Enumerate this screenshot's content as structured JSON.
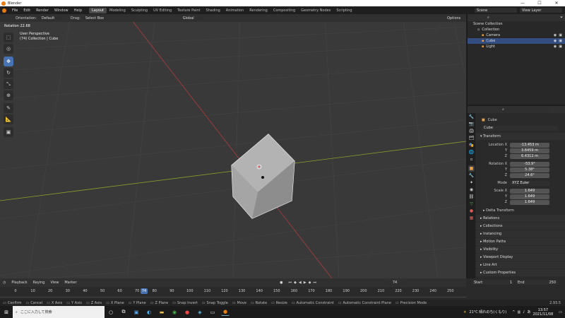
{
  "titlebar": {
    "app": "Blender",
    "min": "—",
    "max": "☐",
    "close": "✕"
  },
  "menubar": {
    "items": [
      "File",
      "Edit",
      "Render",
      "Window",
      "Help"
    ],
    "workspaces": [
      "Layout",
      "Modeling",
      "Sculpting",
      "UV Editing",
      "Texture Paint",
      "Shading",
      "Animation",
      "Rendering",
      "Compositing",
      "Geometry Nodes",
      "Scripting"
    ],
    "active_workspace": "Layout",
    "scene_label": "Scene",
    "view_layer_label": "View Layer"
  },
  "viewport_header": {
    "orientation_label": "Orientation:",
    "orientation_value": "Default",
    "drag_label": "Drag:",
    "drag_value": "Select Box",
    "transform_space": "Global",
    "options": "Options"
  },
  "viewport": {
    "rotation_readout": "Rotation 22.68",
    "view_name": "User Perspective",
    "collection_info": "(74) Collection | Cube"
  },
  "outliner": {
    "root": "Scene Collection",
    "collection": "Collection",
    "items": [
      {
        "name": "Camera",
        "icon": "camera-icon",
        "color": "#e6a04a",
        "selected": false
      },
      {
        "name": "Cube",
        "icon": "mesh-icon",
        "color": "#e6a04a",
        "selected": true
      },
      {
        "name": "Light",
        "icon": "light-icon",
        "color": "#e6a04a",
        "selected": false
      }
    ]
  },
  "properties": {
    "object_name_header": "Cube",
    "object_name_field": "Cube",
    "transform_header": "Transform",
    "location_label": "Location X",
    "location": [
      "-13.453 m",
      "3.8459 m",
      "6.4312 m"
    ],
    "rotation_label": "Rotation X",
    "rotation": [
      "-53.9°",
      "5.38°",
      "24.6°"
    ],
    "mode_label": "Mode",
    "mode_value": "XYZ Euler",
    "scale_label": "Scale X",
    "scale": [
      "1.649",
      "1.649",
      "1.649"
    ],
    "axis_y": "Y",
    "axis_z": "Z",
    "delta_transform": "Delta Transform",
    "panels": [
      "Relations",
      "Collections",
      "Instancing",
      "Motion Paths",
      "Visibility",
      "Viewport Display",
      "Line Art",
      "Custom Properties"
    ]
  },
  "timeline": {
    "menus": [
      "Playback",
      "Keying",
      "View",
      "Marker"
    ],
    "current_frame": "74",
    "start_label": "Start",
    "start_value": "1",
    "end_label": "End",
    "end_value": "250",
    "ticks": [
      "0",
      "10",
      "20",
      "30",
      "40",
      "50",
      "60",
      "70",
      "80",
      "90",
      "100",
      "110",
      "120",
      "130",
      "140",
      "150",
      "160",
      "170",
      "180",
      "190",
      "200",
      "210",
      "220",
      "230",
      "240",
      "250"
    ],
    "playhead_value": "74"
  },
  "statusbar": {
    "items": [
      "Confirm",
      "Cancel",
      "X Axis",
      "Y Axis",
      "Z Axis",
      "X Plane",
      "Y Plane",
      "Z Plane",
      "Snap Invert",
      "Snap Toggle",
      "Move",
      "Rotate",
      "Resize",
      "Automatic Constraint",
      "Automatic Constraint Plane",
      "Precision Mode"
    ],
    "version": "2.93.5"
  },
  "taskbar": {
    "search_placeholder": "ここに入力して検索",
    "weather": "21°C 晴れのち(くもり)",
    "time": "13:57",
    "date": "2021/11/08"
  }
}
